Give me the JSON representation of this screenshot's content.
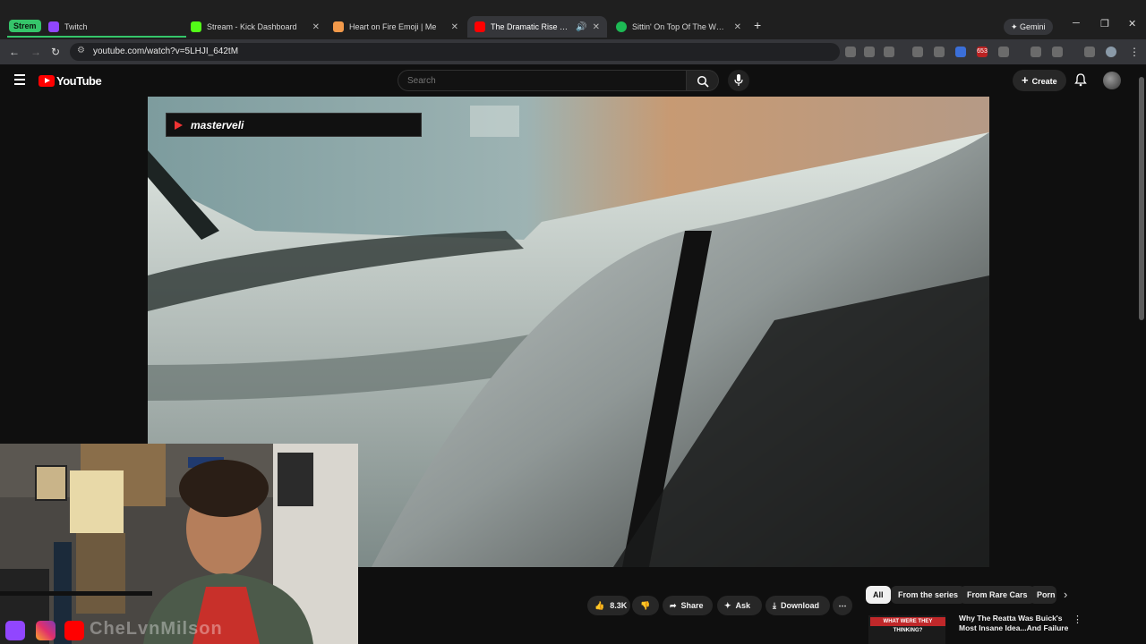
{
  "browser": {
    "group_label": "Strem",
    "tabs": [
      {
        "title": "Twitch",
        "fav_color": "#9146ff"
      },
      {
        "title": "Stream - Kick Dashboard",
        "fav_color": "#53fc18"
      },
      {
        "title": "Heart on Fire Emoji | Me",
        "fav_color": "#f2994a"
      },
      {
        "title": "The Dramatic Rise & Fall Of",
        "fav_color": "#ff0000"
      },
      {
        "title": "Sittin' On Top Of The World",
        "fav_color": "#1db954"
      }
    ],
    "new_tab_label": "+",
    "gemini_label": "Gemini",
    "url": "youtube.com/watch?v=5LHJI_642tM",
    "ext_badge": "653"
  },
  "youtube": {
    "logo_text": "YouTube",
    "search_placeholder": "Search",
    "create_label": "Create"
  },
  "video": {
    "channel_banner": "masterveli"
  },
  "webcam": {
    "handle_text": "CheLvnMilson"
  },
  "actions": {
    "like_count": "8.3K",
    "share_label": "Share",
    "ask_label": "Ask",
    "download_label": "Download",
    "more_label": "⋯"
  },
  "chips": [
    "All",
    "From the series",
    "From Rare Cars",
    "Porn"
  ],
  "recommended": {
    "thumb_text": "WHAT WERE THEY THINKING?",
    "title": "Why The Reatta Was Buick's Most Insane Idea...And Failure"
  }
}
